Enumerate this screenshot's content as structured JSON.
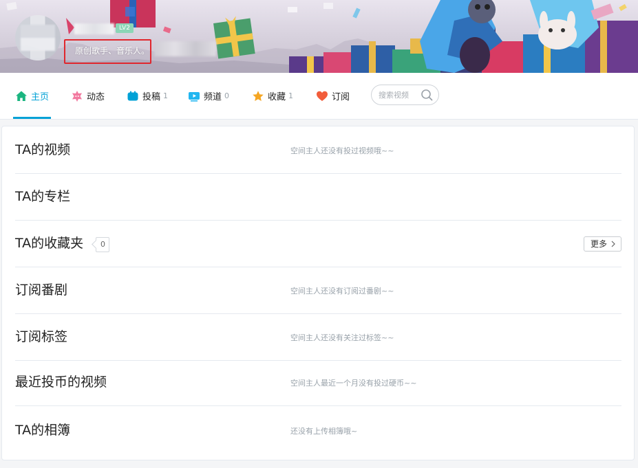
{
  "profile": {
    "level": "LV2",
    "signature": "原创歌手、音乐人。"
  },
  "nav": {
    "items": [
      {
        "label": "主页",
        "count": "",
        "icon": "home-icon",
        "color": "#00a1d6"
      },
      {
        "label": "动态",
        "count": "",
        "icon": "dynamic-icon",
        "color": "#f27aa0"
      },
      {
        "label": "投稿",
        "count": "1",
        "icon": "upload-icon",
        "color": "#00a1d6"
      },
      {
        "label": "频道",
        "count": "0",
        "icon": "channel-icon",
        "color": "#22b6f0"
      },
      {
        "label": "收藏",
        "count": "1",
        "icon": "star-icon",
        "color": "#f5a623"
      },
      {
        "label": "订阅",
        "count": "",
        "icon": "heart-icon",
        "color": "#f25d3b"
      }
    ],
    "search_placeholder": "搜索视频"
  },
  "sections": [
    {
      "title": "TA的视频",
      "empty": "空间主人还没有投过视频哦~~"
    },
    {
      "title": "TA的专栏",
      "empty": ""
    },
    {
      "title": "TA的收藏夹",
      "count": "0",
      "more": "更多"
    },
    {
      "title": "订阅番剧",
      "empty": "空间主人还没有订阅过番剧~~"
    },
    {
      "title": "订阅标签",
      "empty": "空间主人还没有关注过标签~~"
    },
    {
      "title": "最近投币的视频",
      "empty": "空间主人最近一个月没有投过硬币~~"
    },
    {
      "title": "TA的相簿",
      "empty": "还没有上传相簿哦~"
    }
  ],
  "colors": {
    "accent": "#00a1d6",
    "highlight_box": "#e0262c"
  }
}
